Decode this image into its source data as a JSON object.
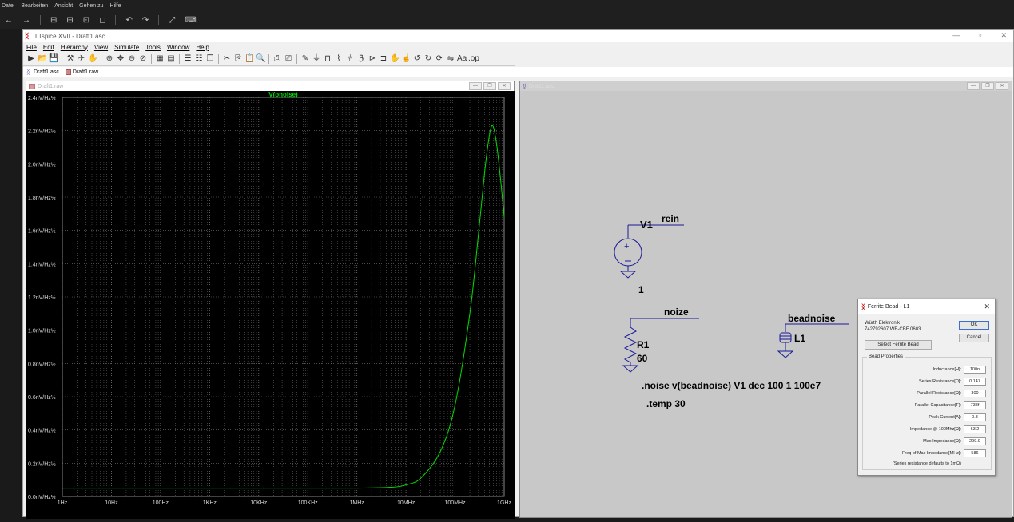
{
  "host": {
    "menu": [
      "Datei",
      "Bearbeiten",
      "Ansicht",
      "Gehen zu",
      "Hilfe"
    ]
  },
  "window": {
    "title": "LTspice XVII - Draft1.asc"
  },
  "menu": [
    "File",
    "Edit",
    "Hierarchy",
    "View",
    "Simulate",
    "Tools",
    "Window",
    "Help"
  ],
  "tabs": [
    {
      "label": "Draft1.asc",
      "icon": "schematic-icon"
    },
    {
      "label": "Draft1.raw",
      "icon": "waveform-icon"
    }
  ],
  "plot": {
    "pane_title": "Draft1.raw",
    "trace_label": "V(onoise)",
    "trace_color": "#00e000",
    "y_ticks": [
      "2.4nV/Hz½",
      "2.2nV/Hz½",
      "2.0nV/Hz½",
      "1.8nV/Hz½",
      "1.6nV/Hz½",
      "1.4nV/Hz½",
      "1.2nV/Hz½",
      "1.0nV/Hz½",
      "0.8nV/Hz½",
      "0.6nV/Hz½",
      "0.4nV/Hz½",
      "0.2nV/Hz½",
      "0.0nV/Hz½"
    ],
    "x_ticks": [
      "1Hz",
      "10Hz",
      "100Hz",
      "1KHz",
      "10KHz",
      "100KHz",
      "1MHz",
      "10MHz",
      "100MHz",
      "1GHz"
    ]
  },
  "chart_data": {
    "type": "line",
    "title": "V(onoise)",
    "xlabel": "",
    "ylabel": "",
    "x_scale": "log",
    "xlim": [
      1,
      1000000000
    ],
    "ylim": [
      0,
      2.4
    ],
    "grid": true,
    "series": [
      {
        "name": "V(onoise)",
        "x": [
          1,
          10,
          100,
          1000,
          10000,
          100000,
          1000000,
          5000000,
          10000000,
          20000000,
          50000000,
          100000000,
          200000000,
          300000000,
          400000000,
          500000000,
          586000000,
          700000000,
          850000000,
          1000000000
        ],
        "y": [
          0.05,
          0.05,
          0.05,
          0.05,
          0.05,
          0.05,
          0.05,
          0.055,
          0.07,
          0.11,
          0.27,
          0.55,
          1.1,
          1.58,
          1.95,
          2.17,
          2.23,
          2.12,
          1.9,
          1.68
        ]
      }
    ]
  },
  "schematic": {
    "pane_title": "Draft1.asc",
    "v1_name": "V1",
    "v1_value": "1",
    "net_rein": "rein",
    "r1_name": "R1",
    "r1_value": "60",
    "net_noize": "noize",
    "l1_name": "L1",
    "net_beadnoise": "beadnoise",
    "directive_noise": ".noise v(beadnoise) V1 dec 100 1 100e7",
    "directive_temp": ".temp 30"
  },
  "dialog": {
    "title": "Ferrite Bead - L1",
    "manufacturer": "Würth Elektronik",
    "part": "742792607 WE-CBF 0603",
    "ok_label": "OK",
    "cancel_label": "Cancel",
    "select_label": "Select Ferrite Bead",
    "group_label": "Bead Properties",
    "props": [
      {
        "label": "Inductance[H]:",
        "value": "100n"
      },
      {
        "label": "Series Resistance[Ω]:",
        "value": "0.147"
      },
      {
        "label": "Parallel Resistance[Ω]:",
        "value": "300"
      },
      {
        "label": "Parallel Capacitance[F]:",
        "value": "738f"
      },
      {
        "label": "Peak Current[A]:",
        "value": "0.3"
      },
      {
        "label": "Impedance @ 100Mhz[Ω]:",
        "value": "63.2"
      },
      {
        "label": "Max Impedance[Ω]:",
        "value": "299.9"
      },
      {
        "label": "Freq of Max Impedance[MHz]:",
        "value": "586"
      }
    ],
    "note": "(Series resistance defaults to 1mΩ)"
  }
}
